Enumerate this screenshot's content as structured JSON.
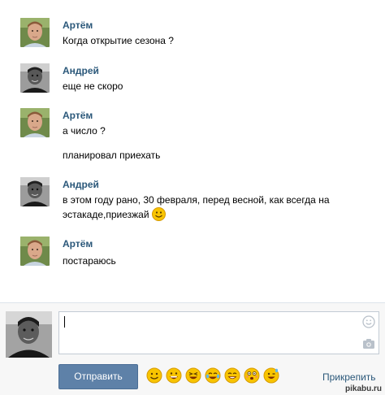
{
  "messages": [
    {
      "author": "Артём",
      "avatar": "young-boy-avatar",
      "lines": [
        "Когда открытие сезона ?"
      ]
    },
    {
      "author": "Андрей",
      "avatar": "man-bw-avatar",
      "lines": [
        "еще не скоро"
      ]
    },
    {
      "author": "Артём",
      "avatar": "young-boy-avatar",
      "lines": [
        "а число ?",
        "планировал приехать"
      ]
    },
    {
      "author": "Андрей",
      "avatar": "man-bw-avatar",
      "lines": [
        "в этом году рано, 30 февраля, перед весной, как всегда на эстакаде,приезжай"
      ],
      "trailing_emoji": "smiley-emoji"
    },
    {
      "author": "Артём",
      "avatar": "young-boy-avatar",
      "lines": [
        "постараюсь"
      ]
    }
  ],
  "composer": {
    "input_value": "",
    "send_label": "Отправить",
    "attach_label": "Прикрепить",
    "emoji_icons": [
      "smile-emoji",
      "grin-emoji",
      "laugh-emoji",
      "tears-joy-emoji",
      "happy-emoji",
      "surprised-emoji",
      "wink-emoji"
    ]
  },
  "watermark": "pikabu.ru",
  "colors": {
    "author_name": "#2b587a",
    "send_button": "#5e81a8",
    "composer_bg": "#f7f7f7"
  }
}
